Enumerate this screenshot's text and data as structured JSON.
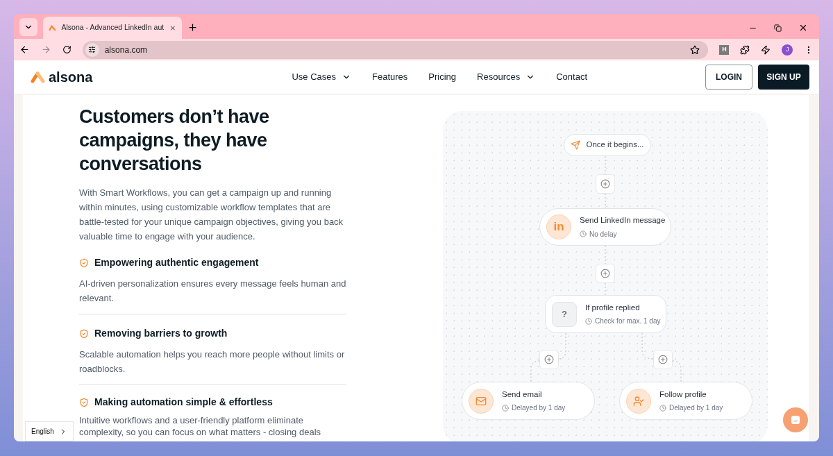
{
  "browser": {
    "tab_title": "Alsona - Advanced LinkedIn aut",
    "url": "alsona.com",
    "profile_initial": "J",
    "extension_label": "H"
  },
  "nav": {
    "logo": "alsona",
    "items": [
      {
        "label": "Use Cases",
        "dropdown": true
      },
      {
        "label": "Features",
        "dropdown": false
      },
      {
        "label": "Pricing",
        "dropdown": false
      },
      {
        "label": "Resources",
        "dropdown": true
      },
      {
        "label": "Contact",
        "dropdown": false
      }
    ],
    "login": "LOGIN",
    "signup": "SIGN UP"
  },
  "hero": {
    "title": "Customers don’t have campaigns, they have conversations",
    "intro": "With Smart Workflows, you can get a campaign up and running within minutes, using customizable workflow templates that are battle-tested for your unique campaign objectives, giving you back valuable time to engage with your audience.",
    "features": [
      {
        "title": "Empowering authentic engagement",
        "text": "AI-driven personalization ensures every message feels human and relevant."
      },
      {
        "title": "Removing barriers to growth",
        "text": "Scalable automation helps you reach more people without limits or roadblocks."
      },
      {
        "title": "Making automation simple & effortless",
        "text": "Intuitive workflows and a user-friendly platform eliminate complexity, so you can focus on what matters - closing deals"
      }
    ]
  },
  "workflow": {
    "start": "Once it begins...",
    "nodes": [
      {
        "kind": "linkedin",
        "title": "Send LinkedIn message",
        "detail": "No delay",
        "badge": "in"
      },
      {
        "kind": "condition",
        "title": "If profile replied",
        "detail": "Check for max. 1 day",
        "badge": "?"
      },
      {
        "kind": "email",
        "title": "Send email",
        "detail": "Delayed by 1 day"
      },
      {
        "kind": "follow",
        "title": "Follow profile",
        "detail": "Delayed by 1 day"
      }
    ]
  },
  "language": "English"
}
